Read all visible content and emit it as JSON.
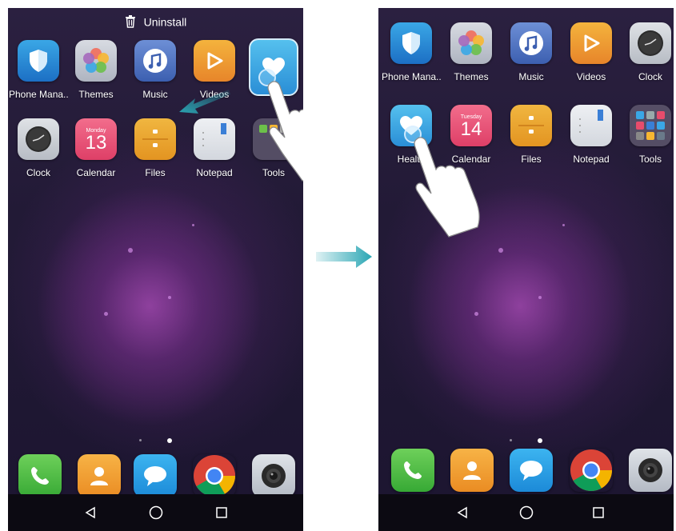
{
  "left_screen": {
    "uninstall_label": "Uninstall",
    "row1": [
      {
        "label": "Phone Mana..",
        "icon": "shield-icon"
      },
      {
        "label": "Themes",
        "icon": "flower-icon"
      },
      {
        "label": "Music",
        "icon": "music-note-icon"
      },
      {
        "label": "Videos",
        "icon": "play-icon"
      }
    ],
    "row2": [
      {
        "label": "Clock",
        "icon": "clock-icon"
      },
      {
        "label": "Calendar",
        "icon": "calendar-icon",
        "day_name": "Monday",
        "day_number": "13"
      },
      {
        "label": "Files",
        "icon": "folder-icon"
      },
      {
        "label": "Notepad",
        "icon": "notepad-icon"
      },
      {
        "label": "Tools",
        "icon": "folder-grid-icon"
      }
    ],
    "dragged_app": {
      "icon": "heart-icon"
    }
  },
  "right_screen": {
    "row1": [
      {
        "label": "Phone Mana..",
        "icon": "shield-icon"
      },
      {
        "label": "Themes",
        "icon": "flower-icon"
      },
      {
        "label": "Music",
        "icon": "music-note-icon"
      },
      {
        "label": "Videos",
        "icon": "play-icon"
      },
      {
        "label": "Clock",
        "icon": "clock-icon"
      }
    ],
    "row2": [
      {
        "label": "Health",
        "icon": "heart-icon"
      },
      {
        "label": "Calendar",
        "icon": "calendar-icon",
        "day_name": "Tuesday",
        "day_number": "14"
      },
      {
        "label": "Files",
        "icon": "folder-icon"
      },
      {
        "label": "Notepad",
        "icon": "notepad-icon"
      },
      {
        "label": "Tools",
        "icon": "folder-grid-icon"
      }
    ]
  },
  "dock": [
    {
      "icon": "phone-icon"
    },
    {
      "icon": "contacts-icon"
    },
    {
      "icon": "messages-icon"
    },
    {
      "icon": "chrome-icon"
    },
    {
      "icon": "camera-icon"
    }
  ],
  "navbar": {
    "back": "back-triangle-icon",
    "home": "home-circle-icon",
    "recents": "recents-square-icon"
  },
  "colors": {
    "arrow": "#2aa6b4",
    "accent": "#3aa7e6"
  }
}
